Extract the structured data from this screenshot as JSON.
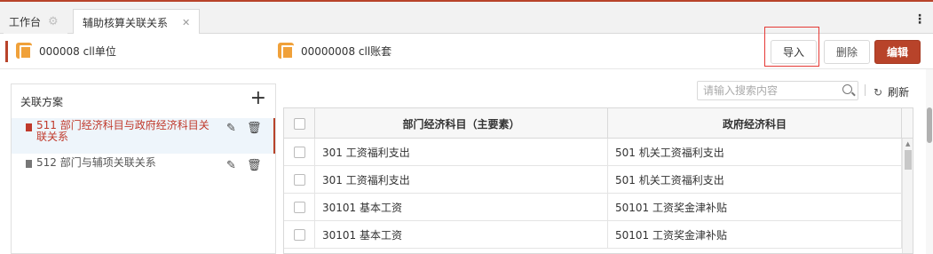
{
  "tabs": [
    {
      "label": "工作台"
    },
    {
      "label": "辅助核算关联关系"
    }
  ],
  "info": {
    "unit": "000008 cll单位",
    "book": "00000008 cll账套"
  },
  "toolbar": {
    "import_label": "导入",
    "delete_label": "删除",
    "edit_label": "编辑"
  },
  "left_panel": {
    "title": "关联方案",
    "add_icon": "+",
    "items": [
      {
        "label": "511 部门经济科目与政府经济科目关联关系",
        "selected": true
      },
      {
        "label": "512 部门与辅项关联关系",
        "selected": false
      }
    ]
  },
  "search": {
    "placeholder": "请输入搜索内容"
  },
  "refresh_label": "刷新",
  "table": {
    "headers": [
      "部门经济科目（主要素）",
      "政府经济科目"
    ],
    "rows": [
      [
        "301 工资福利支出",
        "501 机关工资福利支出"
      ],
      [
        "301 工资福利支出",
        "501 机关工资福利支出"
      ],
      [
        "30101 基本工资",
        "50101 工资奖金津补贴"
      ],
      [
        "30101 基本工资",
        "50101 工资奖金津补贴"
      ]
    ]
  },
  "colors": {
    "accent": "#b8432a",
    "selected_text": "#c0392b",
    "selected_bg": "#eef5fb",
    "info_icon": "#f0a13a"
  }
}
